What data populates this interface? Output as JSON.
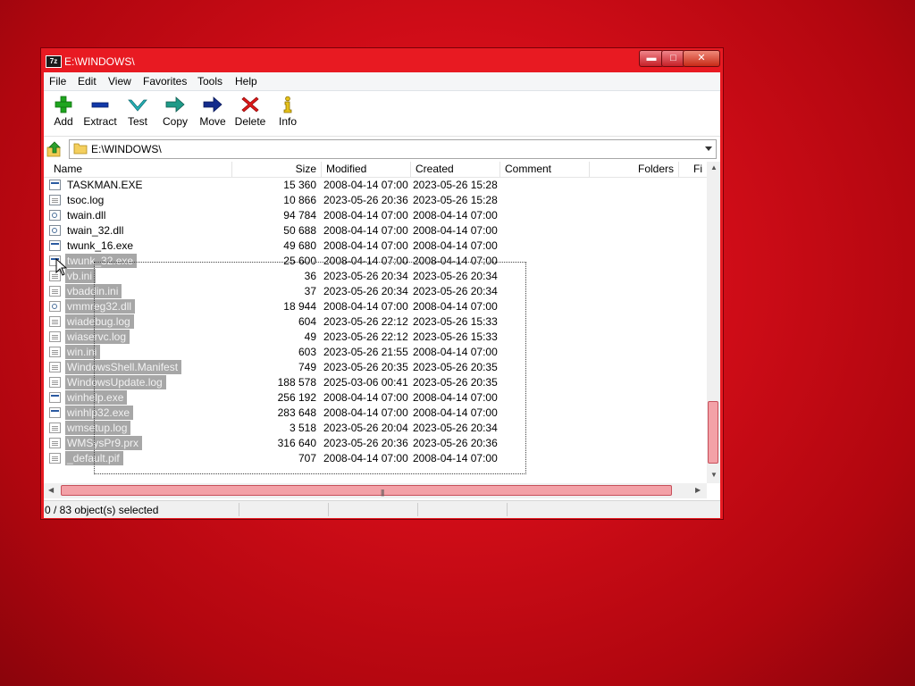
{
  "window": {
    "title": "E:\\WINDOWS\\",
    "app_icon_label": "7z",
    "controls": {
      "minimize": "▬",
      "maximize": "□",
      "close": "✕"
    }
  },
  "menu": [
    "File",
    "Edit",
    "View",
    "Favorites",
    "Tools",
    "Help"
  ],
  "toolbar": [
    {
      "label": "Add",
      "icon": "plus-icon"
    },
    {
      "label": "Extract",
      "icon": "minus-icon"
    },
    {
      "label": "Test",
      "icon": "check-icon"
    },
    {
      "label": "Copy",
      "icon": "copy-arrow-icon"
    },
    {
      "label": "Move",
      "icon": "move-arrow-icon"
    },
    {
      "label": "Delete",
      "icon": "delete-x-icon"
    },
    {
      "label": "Info",
      "icon": "info-icon"
    }
  ],
  "address": {
    "path": "E:\\WINDOWS\\"
  },
  "columns": [
    "Name",
    "Size",
    "Modified",
    "Created",
    "Comment",
    "Folders",
    "Fi"
  ],
  "files": [
    {
      "name": "TASKMAN.EXE",
      "size": "15 360",
      "modified": "2008-04-14 07:00",
      "created": "2023-05-26 15:28",
      "type": "exe",
      "selected": false
    },
    {
      "name": "tsoc.log",
      "size": "10 866",
      "modified": "2023-05-26 20:36",
      "created": "2023-05-26 15:28",
      "type": "txt",
      "selected": false
    },
    {
      "name": "twain.dll",
      "size": "94 784",
      "modified": "2008-04-14 07:00",
      "created": "2008-04-14 07:00",
      "type": "dll",
      "selected": false
    },
    {
      "name": "twain_32.dll",
      "size": "50 688",
      "modified": "2008-04-14 07:00",
      "created": "2008-04-14 07:00",
      "type": "dll",
      "selected": false
    },
    {
      "name": "twunk_16.exe",
      "size": "49 680",
      "modified": "2008-04-14 07:00",
      "created": "2008-04-14 07:00",
      "type": "exe",
      "selected": false
    },
    {
      "name": "twunk_32.exe",
      "size": "25 600",
      "modified": "2008-04-14 07:00",
      "created": "2008-04-14 07:00",
      "type": "exe",
      "selected": true
    },
    {
      "name": "vb.ini",
      "size": "36",
      "modified": "2023-05-26 20:34",
      "created": "2023-05-26 20:34",
      "type": "txt",
      "selected": true
    },
    {
      "name": "vbaddin.ini",
      "size": "37",
      "modified": "2023-05-26 20:34",
      "created": "2023-05-26 20:34",
      "type": "txt",
      "selected": true
    },
    {
      "name": "vmmreg32.dll",
      "size": "18 944",
      "modified": "2008-04-14 07:00",
      "created": "2008-04-14 07:00",
      "type": "dll",
      "selected": true
    },
    {
      "name": "wiadebug.log",
      "size": "604",
      "modified": "2023-05-26 22:12",
      "created": "2023-05-26 15:33",
      "type": "txt",
      "selected": true
    },
    {
      "name": "wiaservc.log",
      "size": "49",
      "modified": "2023-05-26 22:12",
      "created": "2023-05-26 15:33",
      "type": "txt",
      "selected": true
    },
    {
      "name": "win.ini",
      "size": "603",
      "modified": "2023-05-26 21:55",
      "created": "2008-04-14 07:00",
      "type": "txt",
      "selected": true
    },
    {
      "name": "WindowsShell.Manifest",
      "size": "749",
      "modified": "2023-05-26 20:35",
      "created": "2023-05-26 20:35",
      "type": "txt",
      "selected": true
    },
    {
      "name": "WindowsUpdate.log",
      "size": "188 578",
      "modified": "2025-03-06 00:41",
      "created": "2023-05-26 20:35",
      "type": "txt",
      "selected": true
    },
    {
      "name": "winhelp.exe",
      "size": "256 192",
      "modified": "2008-04-14 07:00",
      "created": "2008-04-14 07:00",
      "type": "exe",
      "selected": true
    },
    {
      "name": "winhlp32.exe",
      "size": "283 648",
      "modified": "2008-04-14 07:00",
      "created": "2008-04-14 07:00",
      "type": "exe",
      "selected": true
    },
    {
      "name": "wmsetup.log",
      "size": "3 518",
      "modified": "2023-05-26 20:04",
      "created": "2023-05-26 20:34",
      "type": "txt",
      "selected": true
    },
    {
      "name": "WMSysPr9.prx",
      "size": "316 640",
      "modified": "2023-05-26 20:36",
      "created": "2023-05-26 20:36",
      "type": "txt",
      "selected": true
    },
    {
      "name": "_default.pif",
      "size": "707",
      "modified": "2008-04-14 07:00",
      "created": "2008-04-14 07:00",
      "type": "txt",
      "selected": true
    }
  ],
  "status": {
    "text": "0 / 83 object(s) selected"
  },
  "colors": {
    "desktop": "#d10d18",
    "selection": "#a7a7a7",
    "scroll_thumb": "#f3a1a7"
  }
}
